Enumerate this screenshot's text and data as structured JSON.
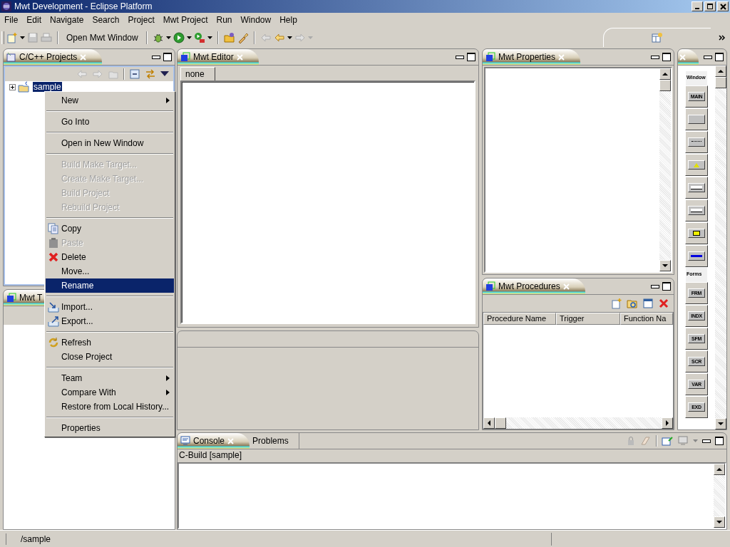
{
  "window": {
    "title": "Mwt Development - Eclipse Platform"
  },
  "menu_bar": [
    "File",
    "Edit",
    "Navigate",
    "Search",
    "Project",
    "Mwt Project",
    "Run",
    "Window",
    "Help"
  ],
  "toolbar": {
    "open_window_button": "Open Mwt Window"
  },
  "projects_view": {
    "tab": {
      "label": "C/C++ Projects",
      "selected": true
    },
    "tree": [
      {
        "label": "sample",
        "expanded": false,
        "selected": true
      }
    ]
  },
  "mwt_tree_view": {
    "tab": {
      "label": "Mwt T",
      "selected": true
    }
  },
  "editor": {
    "tab": {
      "label": "Mwt Editor",
      "selected": true
    },
    "inner_tabs": [
      {
        "label": "none",
        "selected": true
      }
    ]
  },
  "properties_view": {
    "tab": {
      "label": "Mwt Properties",
      "selected": true
    }
  },
  "procedures_view": {
    "tab": {
      "label": "Mwt Procedures",
      "selected": true
    },
    "columns": [
      "Procedure Name",
      "Trigger",
      "Function Na"
    ]
  },
  "palette": {
    "sections": [
      {
        "header": "Window",
        "items": [
          {
            "kind": "text",
            "label": "MAIN"
          },
          {
            "kind": "blank"
          },
          {
            "kind": "dots"
          },
          {
            "kind": "warning"
          },
          {
            "kind": "field"
          },
          {
            "kind": "field"
          },
          {
            "kind": "yellow"
          },
          {
            "kind": "bar"
          }
        ]
      },
      {
        "header": "Forms",
        "items": [
          {
            "kind": "text",
            "label": "FRM"
          },
          {
            "kind": "text",
            "label": "INDX"
          },
          {
            "kind": "text",
            "label": "SFM"
          },
          {
            "kind": "text",
            "label": "SCR"
          },
          {
            "kind": "text",
            "label": "VAR"
          },
          {
            "kind": "text",
            "label": "EXD"
          }
        ]
      }
    ]
  },
  "console_view": {
    "tabs": [
      {
        "label": "Console",
        "selected": true
      },
      {
        "label": "Problems",
        "selected": false
      }
    ],
    "title": "C-Build [sample]"
  },
  "status_bar": {
    "path": "/sample"
  },
  "context_menu": {
    "groups": [
      [
        {
          "label": "New",
          "kind": "plain",
          "submenu": true,
          "disabled": false,
          "selected": false
        }
      ],
      [
        {
          "label": "Go Into",
          "kind": "plain",
          "submenu": false,
          "disabled": false,
          "selected": false
        }
      ],
      [
        {
          "label": "Open in New Window",
          "kind": "plain",
          "submenu": false,
          "disabled": false,
          "selected": false
        }
      ],
      [
        {
          "label": "Build Make Target...",
          "kind": "plain",
          "submenu": false,
          "disabled": true,
          "selected": false
        },
        {
          "label": "Create Make Target...",
          "kind": "plain",
          "submenu": false,
          "disabled": true,
          "selected": false
        },
        {
          "label": "Build Project",
          "kind": "plain",
          "submenu": false,
          "disabled": true,
          "selected": false
        },
        {
          "label": "Rebuild Project",
          "kind": "plain",
          "submenu": false,
          "disabled": true,
          "selected": false
        }
      ],
      [
        {
          "label": "Copy",
          "kind": "copy",
          "submenu": false,
          "disabled": false,
          "selected": false
        },
        {
          "label": "Paste",
          "kind": "paste",
          "submenu": false,
          "disabled": true,
          "selected": false
        },
        {
          "label": "Delete",
          "kind": "delete",
          "submenu": false,
          "disabled": false,
          "selected": false
        },
        {
          "label": "Move...",
          "kind": "plain",
          "submenu": false,
          "disabled": false,
          "selected": false
        },
        {
          "label": "Rename",
          "kind": "plain",
          "submenu": false,
          "disabled": false,
          "selected": true
        }
      ],
      [
        {
          "label": "Import...",
          "kind": "import",
          "submenu": false,
          "disabled": false,
          "selected": false
        },
        {
          "label": "Export...",
          "kind": "export",
          "submenu": false,
          "disabled": false,
          "selected": false
        }
      ],
      [
        {
          "label": "Refresh",
          "kind": "refresh",
          "submenu": false,
          "disabled": false,
          "selected": false
        },
        {
          "label": "Close Project",
          "kind": "plain",
          "submenu": false,
          "disabled": false,
          "selected": false
        }
      ],
      [
        {
          "label": "Team",
          "kind": "plain",
          "submenu": true,
          "disabled": false,
          "selected": false
        },
        {
          "label": "Compare With",
          "kind": "plain",
          "submenu": true,
          "disabled": false,
          "selected": false
        },
        {
          "label": "Restore from Local History...",
          "kind": "plain",
          "submenu": false,
          "disabled": false,
          "selected": false
        }
      ],
      [
        {
          "label": "Properties",
          "kind": "plain",
          "submenu": false,
          "disabled": false,
          "selected": false
        }
      ]
    ]
  }
}
